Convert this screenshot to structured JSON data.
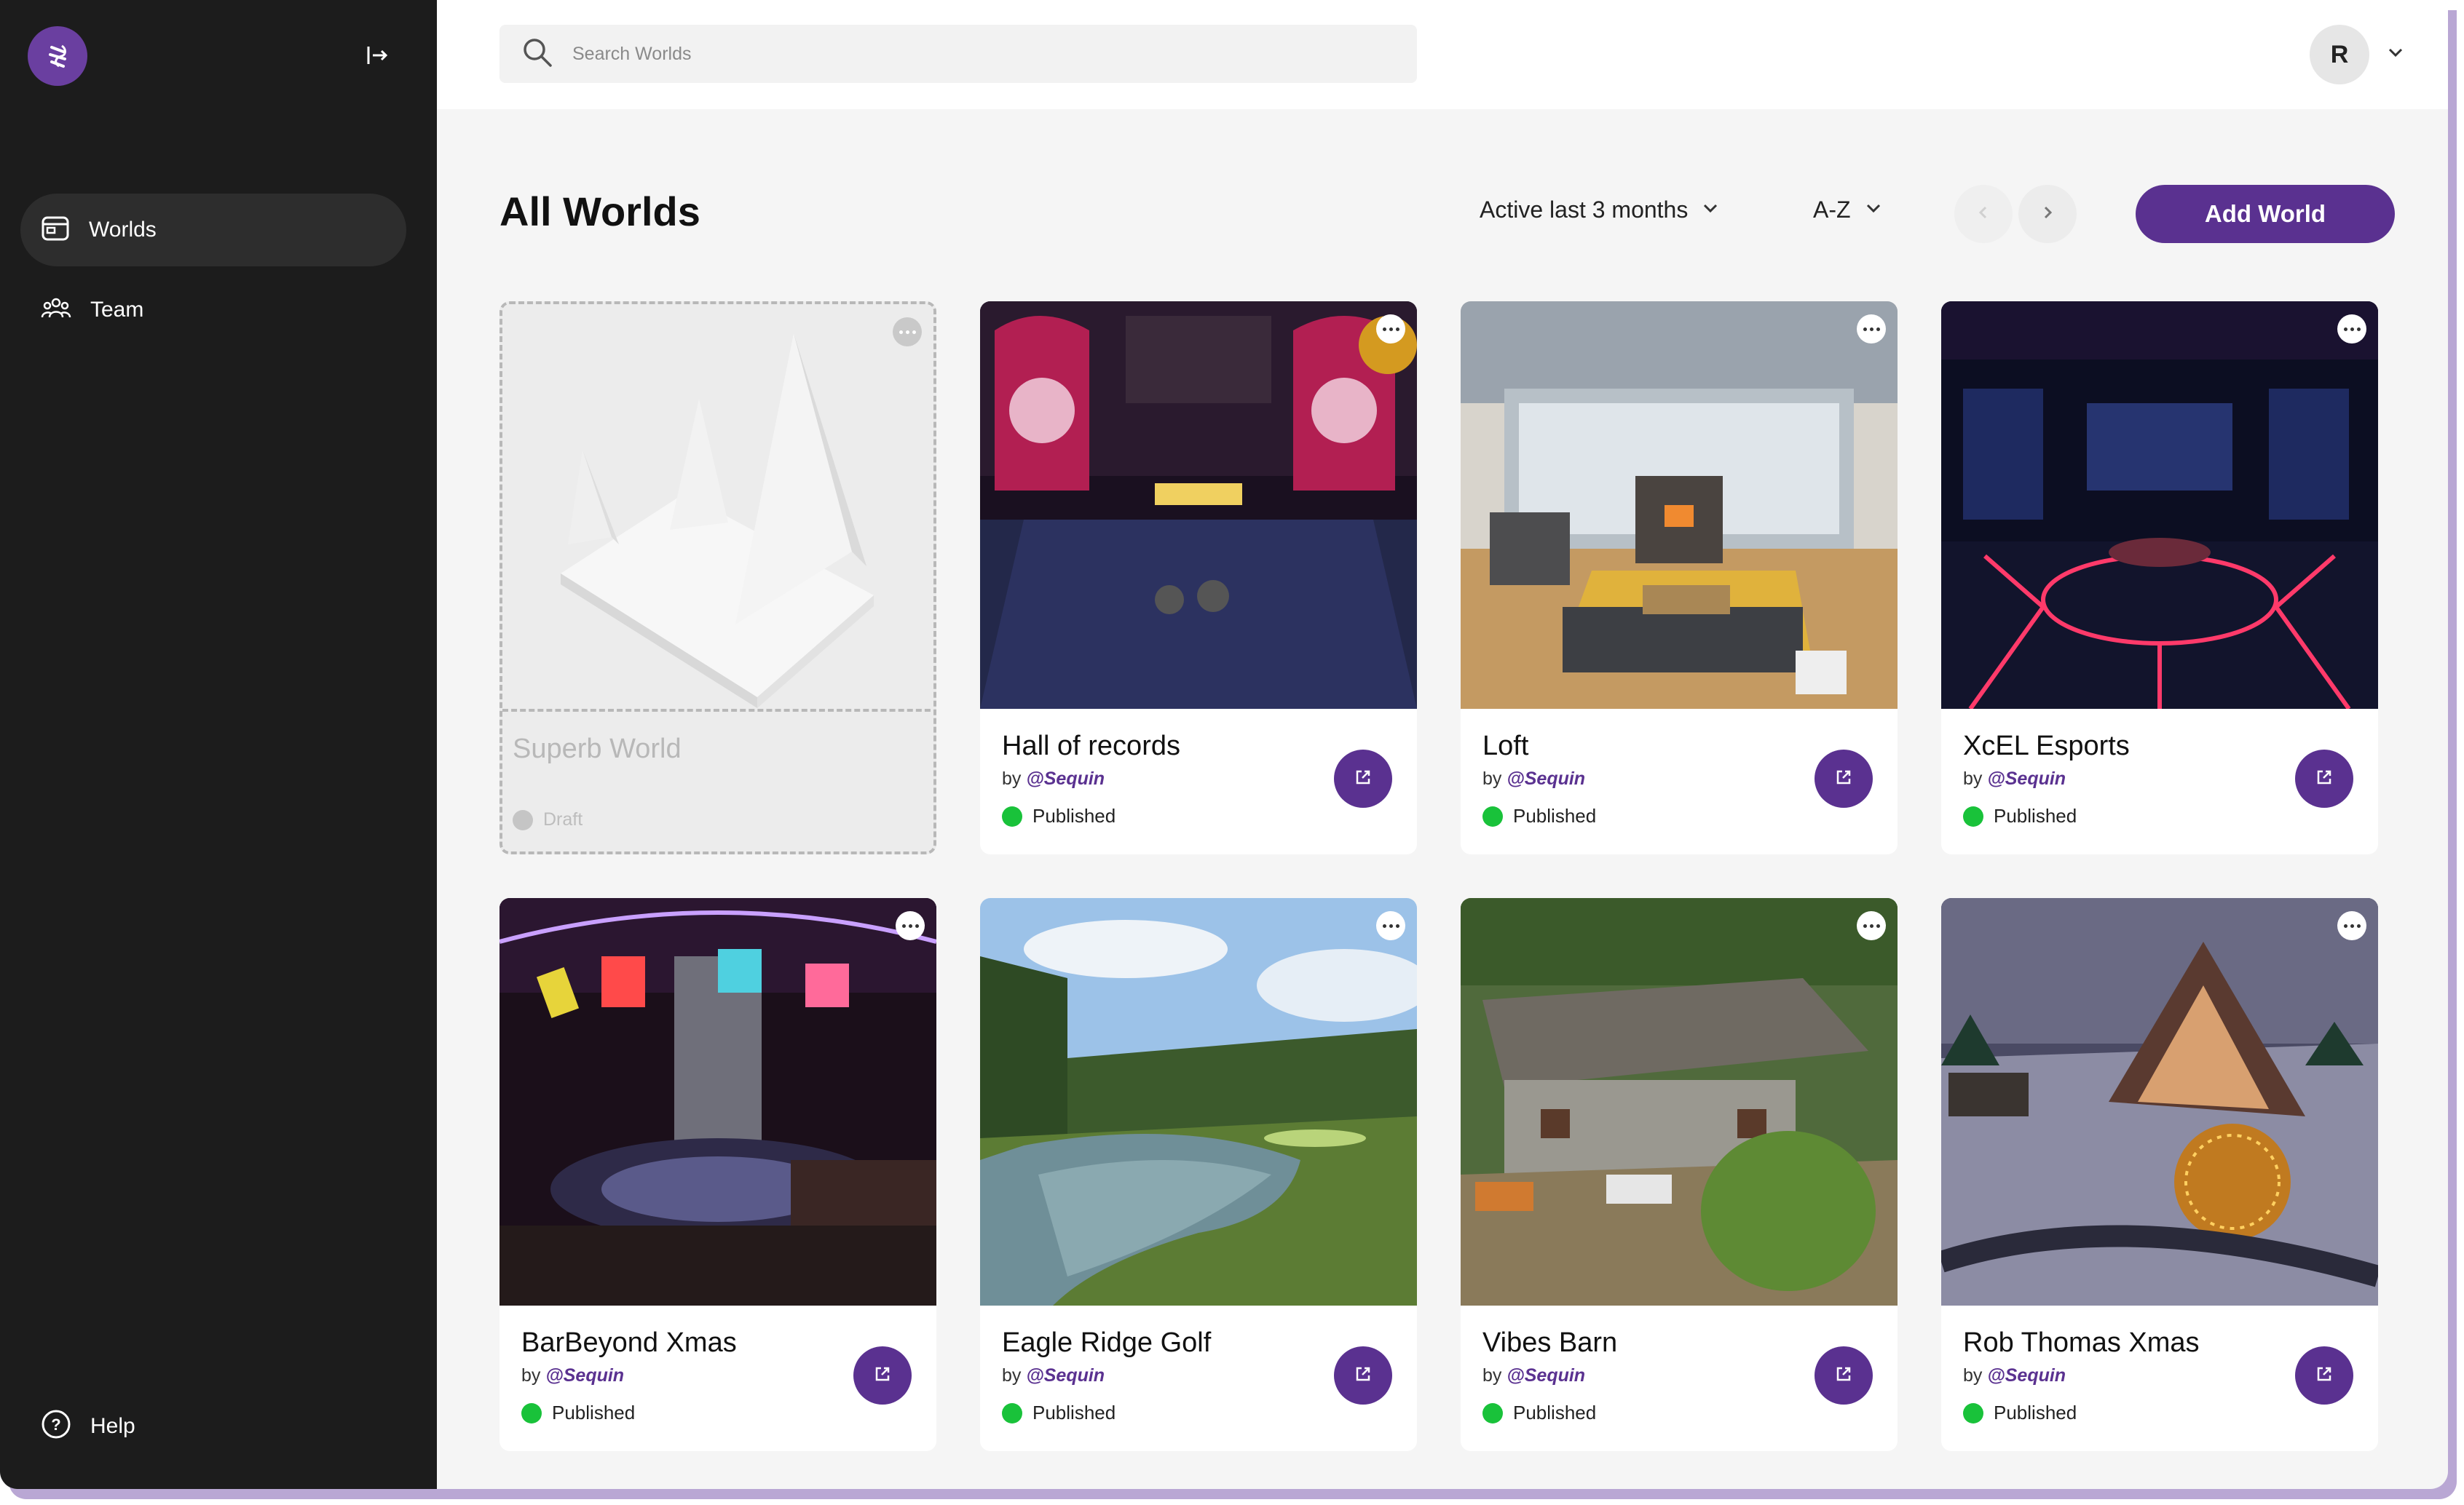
{
  "sidebar": {
    "logo_icon": "sequin-logo-icon",
    "collapse_icon": "collapse-sidebar-icon",
    "items": [
      {
        "label": "Worlds",
        "icon": "worlds-icon",
        "active": true
      },
      {
        "label": "Team",
        "icon": "team-icon",
        "active": false
      }
    ],
    "help_label": "Help"
  },
  "header": {
    "search_placeholder": "Search Worlds",
    "avatar_initial": "R"
  },
  "toolbar": {
    "title": "All Worlds",
    "filter_label": "Active last 3 months",
    "sort_label": "A-Z",
    "add_label": "Add World"
  },
  "colors": {
    "accent": "#5a3190",
    "sidebar_bg": "#1c1c1c",
    "published": "#19c23a"
  },
  "worlds": [
    {
      "name": "Superb World",
      "author_prefix": "",
      "author": "",
      "status": "Draft"
    },
    {
      "name": "Hall of records",
      "author_prefix": "by ",
      "author": "@Sequin",
      "status": "Published"
    },
    {
      "name": "Loft",
      "author_prefix": "by ",
      "author": "@Sequin",
      "status": "Published"
    },
    {
      "name": "XcEL Esports",
      "author_prefix": "by ",
      "author": "@Sequin",
      "status": "Published"
    },
    {
      "name": "BarBeyond Xmas",
      "author_prefix": "by ",
      "author": "@Sequin",
      "status": "Published"
    },
    {
      "name": "Eagle Ridge Golf",
      "author_prefix": "by ",
      "author": "@Sequin",
      "status": "Published"
    },
    {
      "name": "Vibes Barn",
      "author_prefix": "by ",
      "author": "@Sequin",
      "status": "Published"
    },
    {
      "name": "Rob Thomas Xmas",
      "author_prefix": "by ",
      "author": "@Sequin",
      "status": "Published"
    }
  ]
}
